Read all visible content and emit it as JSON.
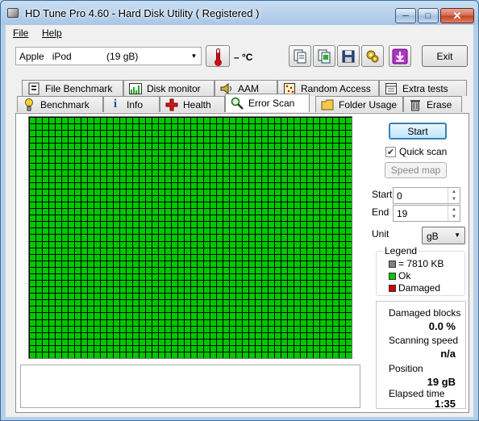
{
  "window": {
    "title": "HD Tune Pro 4.60 - Hard Disk Utility  ( Registered )"
  },
  "menu": {
    "file": "File",
    "help": "Help"
  },
  "toolbar": {
    "drive": "Apple   iPod             (19 gB)",
    "temperature": "– °C",
    "exit_label": "Exit"
  },
  "tabs_top": [
    {
      "label": "File Benchmark",
      "icon": "file-benchmark-icon"
    },
    {
      "label": "Disk monitor",
      "icon": "disk-monitor-icon"
    },
    {
      "label": "AAM",
      "icon": "speaker-icon"
    },
    {
      "label": "Random Access",
      "icon": "random-access-icon"
    },
    {
      "label": "Extra tests",
      "icon": "extra-tests-icon"
    }
  ],
  "tabs_bottom": [
    {
      "label": "Benchmark",
      "icon": "benchmark-icon"
    },
    {
      "label": "Info",
      "icon": "info-icon"
    },
    {
      "label": "Health",
      "icon": "health-icon"
    },
    {
      "label": "Error Scan",
      "icon": "magnifier-icon",
      "active": true
    },
    {
      "label": "Folder Usage",
      "icon": "folder-icon"
    },
    {
      "label": "Erase",
      "icon": "trash-icon"
    }
  ],
  "scan": {
    "start_button": "Start",
    "quick_scan_label": "Quick scan",
    "quick_scan_checked": true,
    "speed_map_button": "Speed map",
    "start_label": "Start",
    "start_value": "0",
    "end_label": "End",
    "end_value": "19",
    "unit_label": "Unit",
    "unit_value": "gB",
    "grid_columns": 50,
    "grid_rows": 37,
    "block_color": "#00c800",
    "grid_line_color": "#000000"
  },
  "legend": {
    "title": "Legend",
    "block_size": "= 7810 KB",
    "ok": "Ok",
    "damaged": "Damaged",
    "block_color": "#808080",
    "ok_color": "#00c800",
    "damaged_color": "#d00000"
  },
  "stats": {
    "damaged_blocks_label": "Damaged blocks",
    "damaged_blocks_value": "0.0 %",
    "scanning_speed_label": "Scanning speed",
    "scanning_speed_value": "n/a",
    "position_label": "Position",
    "position_value": "19 gB",
    "elapsed_time_label": "Elapsed time",
    "elapsed_time_value": "1:35"
  }
}
